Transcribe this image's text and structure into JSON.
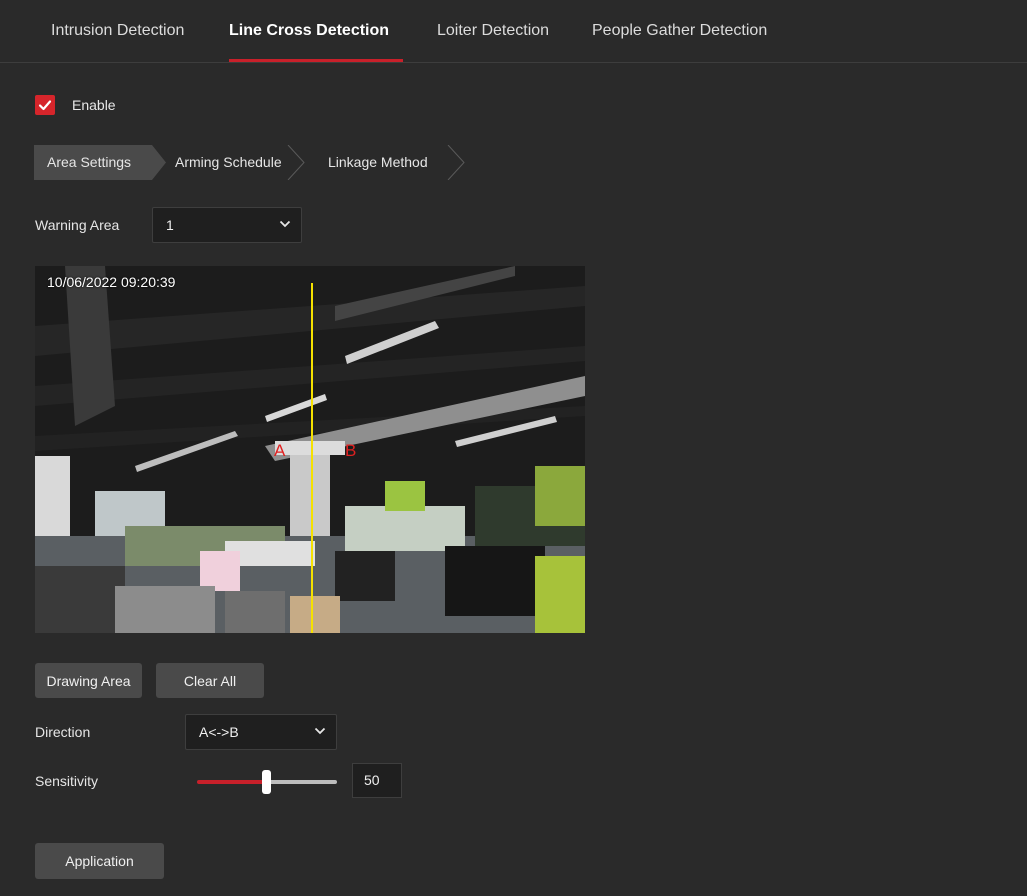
{
  "tabs": [
    {
      "label": "Intrusion Detection",
      "active": false
    },
    {
      "label": "Line Cross Detection",
      "active": true
    },
    {
      "label": "Loiter Detection",
      "active": false
    },
    {
      "label": "People Gather Detection",
      "active": false
    }
  ],
  "enable": {
    "label": "Enable",
    "checked": true
  },
  "steps": [
    {
      "label": "Area Settings",
      "active": true
    },
    {
      "label": "Arming Schedule",
      "active": false
    },
    {
      "label": "Linkage Method",
      "active": false
    }
  ],
  "warning_area": {
    "label": "Warning Area",
    "value": "1"
  },
  "video": {
    "timestamp": "10/06/2022  09:20:39",
    "side_a": "A",
    "side_b": "B"
  },
  "buttons": {
    "drawing_area": "Drawing Area",
    "clear_all": "Clear All",
    "application": "Application"
  },
  "direction": {
    "label": "Direction",
    "value": "A<->B"
  },
  "sensitivity": {
    "label": "Sensitivity",
    "value": "50",
    "level": 0.5
  },
  "colors": {
    "accent": "#c8202a",
    "background": "#2a2a2a",
    "line": "#f5e100"
  },
  "icons": [
    "check-icon",
    "chevron-down-icon"
  ]
}
